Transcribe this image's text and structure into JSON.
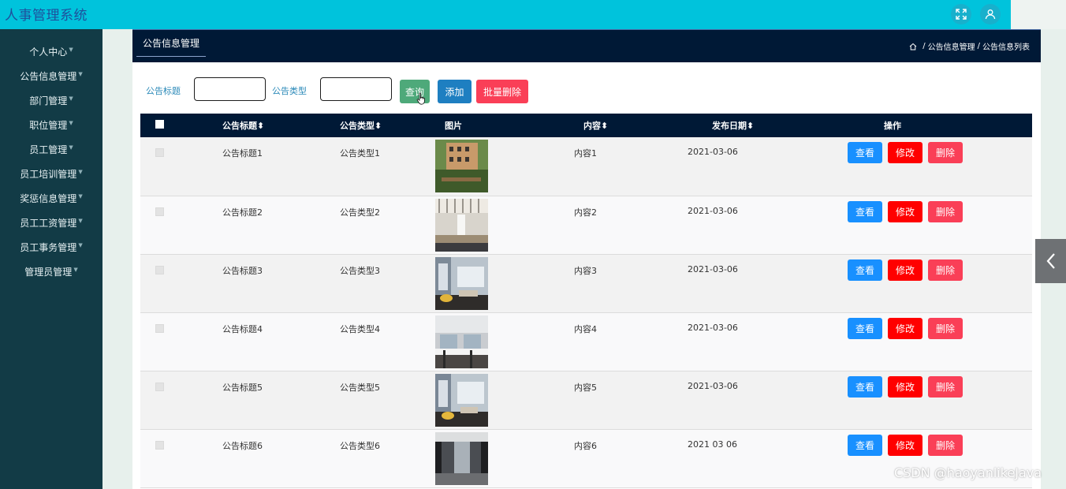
{
  "app": {
    "title": "人事管理系统"
  },
  "topbar": {
    "icons": [
      "fullscreen-icon",
      "user-icon"
    ],
    "color": "#00c3dc"
  },
  "sidebar": {
    "items": [
      {
        "label": "个人中心"
      },
      {
        "label": "公告信息管理"
      },
      {
        "label": "部门管理"
      },
      {
        "label": "职位管理"
      },
      {
        "label": "员工管理"
      },
      {
        "label": "员工培训管理"
      },
      {
        "label": "奖惩信息管理"
      },
      {
        "label": "员工工资管理"
      },
      {
        "label": "员工事务管理"
      },
      {
        "label": "管理员管理"
      }
    ]
  },
  "header": {
    "tab_label": "公告信息管理",
    "breadcrumb": [
      "公告信息管理",
      "公告信息列表"
    ]
  },
  "search": {
    "title_label": "公告标题",
    "title_value": "",
    "type_label": "公告类型",
    "type_value": "",
    "query_label": "查询",
    "add_label": "添加",
    "batch_delete_label": "批量删除"
  },
  "table": {
    "columns": [
      "公告标题",
      "公告类型",
      "图片",
      "内容",
      "发布日期",
      "操作"
    ],
    "sort_icons": [
      "sort-icon",
      "sort-icon",
      "sort-icon",
      "sort-icon"
    ],
    "rows": [
      {
        "title": "公告标题1",
        "type": "公告类型1",
        "content": "内容1",
        "date": "2021-03-06",
        "image": "office-photo"
      },
      {
        "title": "公告标题2",
        "type": "公告类型2",
        "content": "内容2",
        "date": "2021-03-06",
        "image": "office-photo"
      },
      {
        "title": "公告标题3",
        "type": "公告类型3",
        "content": "内容3",
        "date": "2021-03-06",
        "image": "office-photo"
      },
      {
        "title": "公告标题4",
        "type": "公告类型4",
        "content": "内容4",
        "date": "2021-03-06",
        "image": "office-photo"
      },
      {
        "title": "公告标题5",
        "type": "公告类型5",
        "content": "内容5",
        "date": "2021-03-06",
        "image": "office-photo"
      },
      {
        "title": "公告标题6",
        "type": "公告类型6",
        "content": "内容6",
        "date": "2021 03 06",
        "image": "office-photo"
      }
    ],
    "actions": {
      "view": "查看",
      "edit": "修改",
      "delete": "删除"
    }
  },
  "watermark": "CSDN @haoyanlikeJava",
  "colors": {
    "header_bg": "#001936",
    "sidebar_bg": "#123b46",
    "view_button": "#1890ff",
    "edit_button": "#ff0000",
    "delete_button": "#fa3f57",
    "query_button": "#4ea97a",
    "add_button": "#1e7fc1"
  }
}
